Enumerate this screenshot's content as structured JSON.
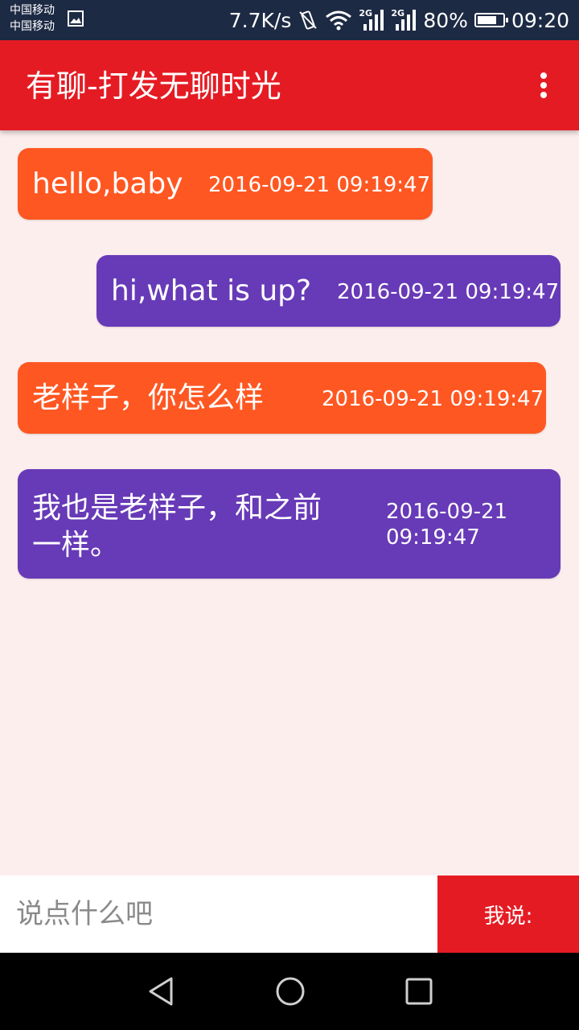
{
  "status_bar": {
    "carrier_1": "中国移动",
    "carrier_2": "中国移动",
    "speed": "7.7K/s",
    "network_1": "2G",
    "network_2": "2G",
    "battery_percent": "80%",
    "battery_level": 0.8,
    "time": "09:20"
  },
  "app_bar": {
    "title": "有聊-打发无聊时光",
    "menu_icon": "more-vert-icon"
  },
  "messages": [
    {
      "text": "hello,baby",
      "time": "2016-09-21 09:19:47",
      "side": "left",
      "color": "#ff5722"
    },
    {
      "text": "hi,what is up?",
      "time": "2016-09-21 09:19:47",
      "side": "right",
      "color": "#673ab7"
    },
    {
      "text": "老样子，你怎么样",
      "time": "2016-09-21 09:19:47",
      "side": "left",
      "color": "#ff5722"
    },
    {
      "text_line_1": "我也是老样子，和之前",
      "text_line_2": "一样。",
      "time_line_1": "2016-09-21",
      "time_line_2": "09:19:47",
      "side": "left",
      "color": "#673ab7"
    }
  ],
  "input": {
    "placeholder": "说点什么吧",
    "value": "",
    "send_label": "我说:"
  },
  "nav_bar": {
    "back_icon": "back-triangle-icon",
    "home_icon": "home-circle-icon",
    "recents_icon": "recents-square-icon"
  },
  "colors": {
    "accent": "#e51b23",
    "background": "#fdeeee",
    "incoming_bubble": "#ff5722",
    "outgoing_bubble": "#673ab7"
  }
}
